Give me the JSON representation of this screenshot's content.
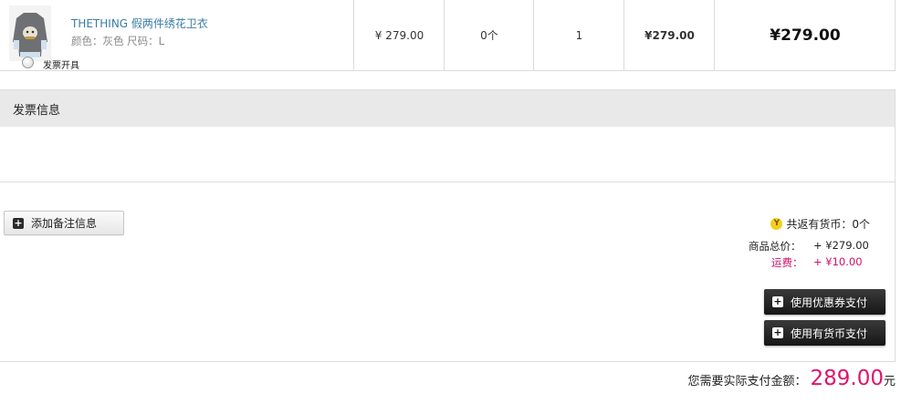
{
  "product": {
    "name": "THETHING 假两件绣花卫衣",
    "attributes": "颜色：灰色 尺码：L",
    "price": "¥ 279.00",
    "coins": "0个",
    "quantity": "1",
    "subtotal": "¥279.00",
    "total": "¥279.00"
  },
  "invoice": {
    "title": "发票信息",
    "option_label": "发票开具"
  },
  "actions": {
    "add_note": "添加备注信息",
    "use_coupon": "使用优惠券支付",
    "use_coin": "使用有货币支付"
  },
  "summary": {
    "coin_return": "共返有货币：0个",
    "goods_label": "商品总价：",
    "goods_value": "+ ¥279.00",
    "shipping_label": "运费：",
    "shipping_value": "+ ¥10.00",
    "pay_label": "您需要实际支付金额：",
    "pay_amount": "289.00",
    "pay_unit": "元"
  },
  "colors": {
    "accent_pink": "#e0146c",
    "link_blue": "#3a7ca5",
    "coin_yellow": "#f3cf1b"
  },
  "icons": [
    "product-thumbnail",
    "plus-icon",
    "coin-icon",
    "radio-icon"
  ]
}
